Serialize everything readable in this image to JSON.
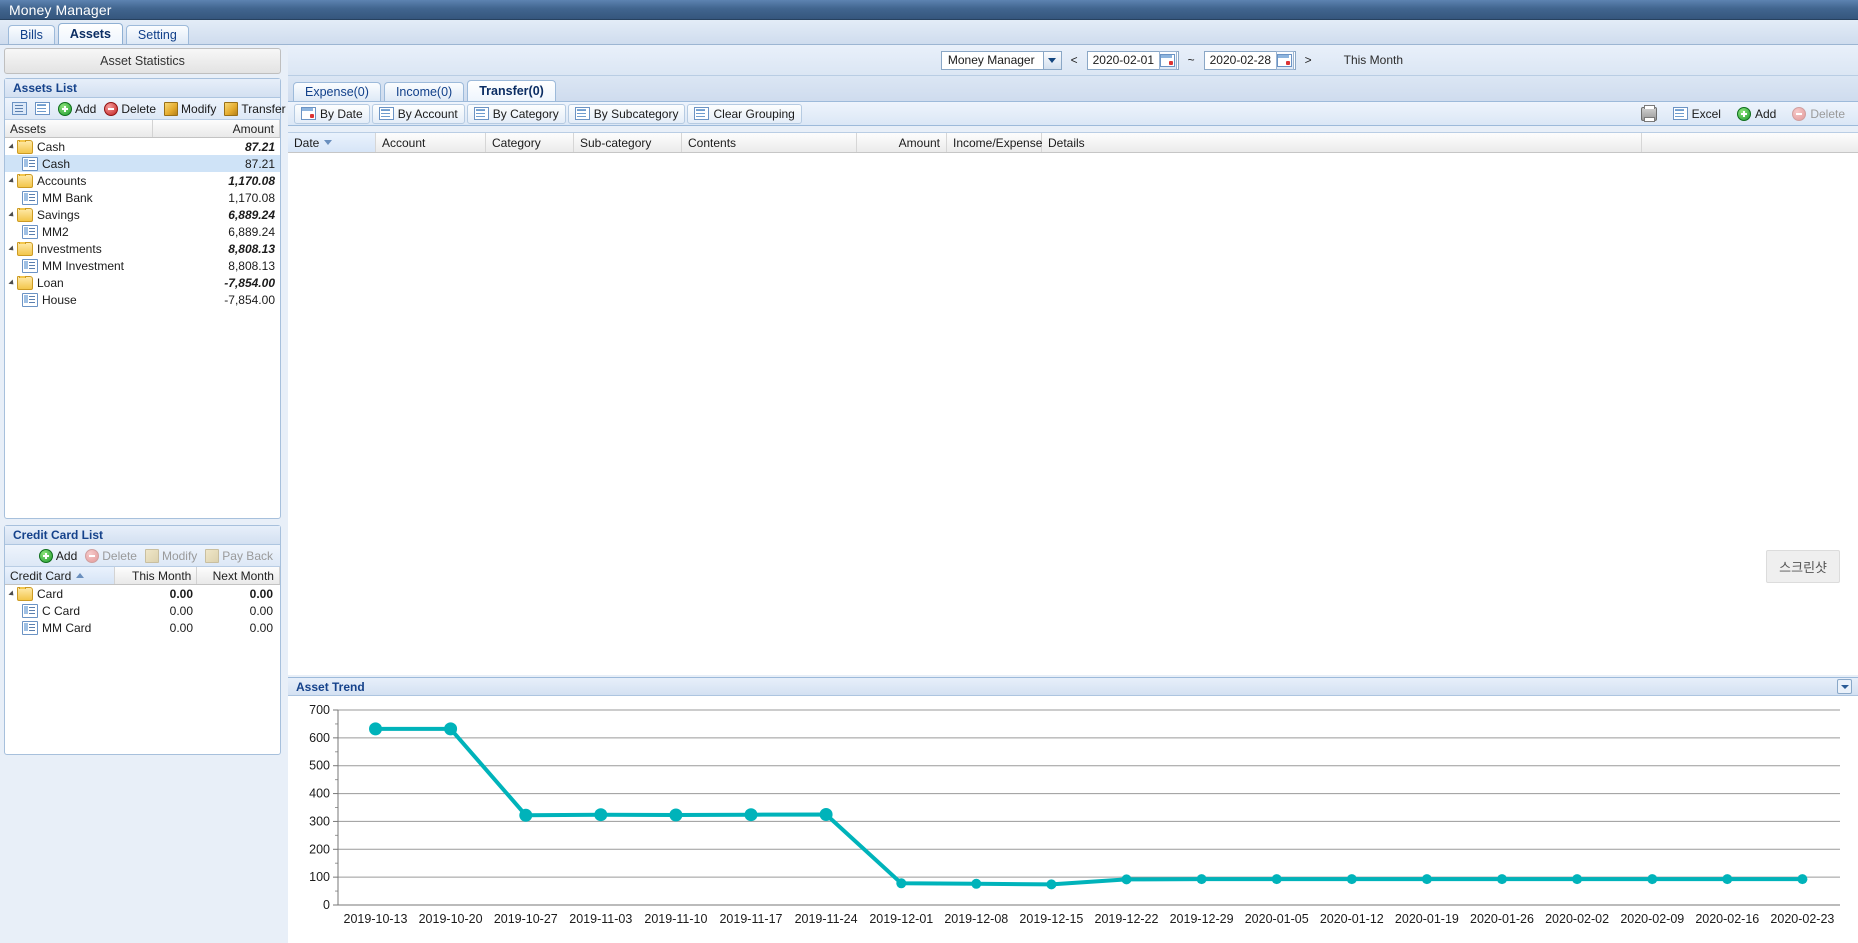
{
  "window": {
    "title": "Money Manager"
  },
  "main_tabs": [
    {
      "label": "Bills",
      "active": false
    },
    {
      "label": "Assets",
      "active": true
    },
    {
      "label": "Setting",
      "active": false
    }
  ],
  "sidebar": {
    "asset_statistics_label": "Asset Statistics",
    "assets_panel": {
      "title": "Assets List",
      "toolbar": [
        {
          "name": "list-view",
          "label": ""
        },
        {
          "name": "tree-view",
          "label": ""
        },
        {
          "name": "add",
          "label": "Add",
          "disabled": false
        },
        {
          "name": "delete",
          "label": "Delete",
          "disabled": false
        },
        {
          "name": "modify",
          "label": "Modify",
          "disabled": false
        },
        {
          "name": "transfer",
          "label": "Transfer",
          "disabled": false
        }
      ],
      "columns": [
        "Assets",
        "Amount"
      ],
      "rows": [
        {
          "name": "Cash",
          "amount": "87.21",
          "type": "group",
          "selected": false
        },
        {
          "name": "Cash",
          "amount": "87.21",
          "type": "item",
          "selected": true
        },
        {
          "name": "Accounts",
          "amount": "1,170.08",
          "type": "group",
          "selected": false
        },
        {
          "name": "MM Bank",
          "amount": "1,170.08",
          "type": "item",
          "selected": false
        },
        {
          "name": "Savings",
          "amount": "6,889.24",
          "type": "group",
          "selected": false
        },
        {
          "name": "MM2",
          "amount": "6,889.24",
          "type": "item",
          "selected": false
        },
        {
          "name": "Investments",
          "amount": "8,808.13",
          "type": "group",
          "selected": false
        },
        {
          "name": "MM Investment",
          "amount": "8,808.13",
          "type": "item",
          "selected": false
        },
        {
          "name": "Loan",
          "amount": "-7,854.00",
          "type": "group",
          "selected": false
        },
        {
          "name": "House",
          "amount": "-7,854.00",
          "type": "item",
          "selected": false
        }
      ]
    },
    "credit_panel": {
      "title": "Credit Card List",
      "toolbar": [
        {
          "name": "add",
          "label": "Add",
          "disabled": false
        },
        {
          "name": "delete",
          "label": "Delete",
          "disabled": true
        },
        {
          "name": "modify",
          "label": "Modify",
          "disabled": true
        },
        {
          "name": "payback",
          "label": "Pay Back",
          "disabled": true
        }
      ],
      "columns": [
        "Credit Card",
        "This Month",
        "Next Month"
      ],
      "rows": [
        {
          "name": "Card",
          "this_month": "0.00",
          "next_month": "0.00",
          "type": "group"
        },
        {
          "name": "C Card",
          "this_month": "0.00",
          "next_month": "0.00",
          "type": "item"
        },
        {
          "name": "MM Card",
          "this_month": "0.00",
          "next_month": "0.00",
          "type": "item"
        }
      ]
    }
  },
  "filterbar": {
    "account_select": "Money Manager",
    "prev_label": "<",
    "next_label": ">",
    "date_from": "2020-02-01",
    "date_to": "2020-02-28",
    "range_separator": "~",
    "period_label": "This Month"
  },
  "sub_tabs": [
    {
      "label": "Expense(0)",
      "active": false
    },
    {
      "label": "Income(0)",
      "active": false
    },
    {
      "label": "Transfer(0)",
      "active": true
    }
  ],
  "group_toolbar": [
    {
      "name": "by-date",
      "label": "By Date"
    },
    {
      "name": "by-account",
      "label": "By Account"
    },
    {
      "name": "by-category",
      "label": "By Category"
    },
    {
      "name": "by-subcategory",
      "label": "By Subcategory"
    },
    {
      "name": "clear-grouping",
      "label": "Clear Grouping"
    }
  ],
  "grid_toolbar": [
    {
      "name": "print",
      "label": "",
      "disabled": false
    },
    {
      "name": "excel",
      "label": "Excel",
      "disabled": false
    },
    {
      "name": "add",
      "label": "Add",
      "disabled": false
    },
    {
      "name": "delete",
      "label": "Delete",
      "disabled": true
    }
  ],
  "table": {
    "columns": [
      {
        "label": "Date",
        "sorted": true,
        "align": "left"
      },
      {
        "label": "Account",
        "sorted": false,
        "align": "left"
      },
      {
        "label": "Category",
        "sorted": false,
        "align": "left"
      },
      {
        "label": "Sub-category",
        "sorted": false,
        "align": "left"
      },
      {
        "label": "Contents",
        "sorted": false,
        "align": "left"
      },
      {
        "label": "Amount",
        "sorted": false,
        "align": "right"
      },
      {
        "label": "Income/Expense",
        "sorted": false,
        "align": "left"
      },
      {
        "label": "Details",
        "sorted": false,
        "align": "left"
      }
    ],
    "rows": []
  },
  "watermark": {
    "text": "스크린샷"
  },
  "chart_panel": {
    "title": "Asset Trend"
  },
  "chart_data": {
    "type": "line",
    "title": "Asset Trend",
    "xlabel": "",
    "ylabel": "",
    "ylim": [
      0,
      700
    ],
    "yticks": [
      0,
      100,
      200,
      300,
      400,
      500,
      600,
      700
    ],
    "grid": true,
    "legend": false,
    "series_color": "#00b3ba",
    "categories": [
      "2019-10-13",
      "2019-10-20",
      "2019-10-27",
      "2019-11-03",
      "2019-11-10",
      "2019-11-17",
      "2019-11-24",
      "2019-12-01",
      "2019-12-08",
      "2019-12-15",
      "2019-12-22",
      "2019-12-29",
      "2020-01-05",
      "2020-01-12",
      "2020-01-19",
      "2020-01-26",
      "2020-02-02",
      "2020-02-09",
      "2020-02-16",
      "2020-02-23"
    ],
    "values": [
      632,
      632,
      322,
      324,
      323,
      324,
      325,
      78,
      76,
      74,
      92,
      93,
      93,
      93,
      93,
      93,
      93,
      93,
      93,
      93
    ]
  }
}
